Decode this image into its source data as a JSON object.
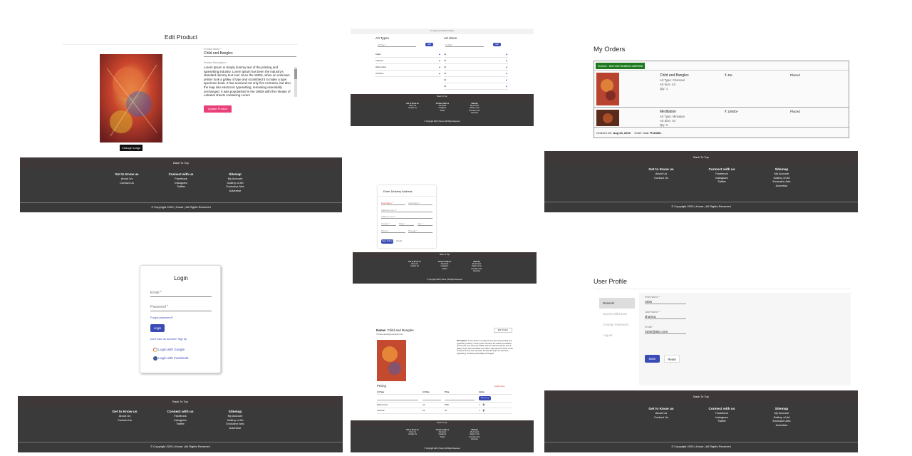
{
  "footer": {
    "back_to_top": "Back To Top",
    "col1_title": "Get to Know us",
    "col1_items": [
      "About Us",
      "Contact Us"
    ],
    "col2_title": "Connect with us",
    "col2_items": [
      "Facebook",
      "Instagram",
      "Twitter"
    ],
    "col3_title": "Sitemap",
    "col3_items": [
      "My Account",
      "Gallery of Art",
      "Exclusive Arts",
      "Advertise"
    ],
    "copyright": "© Copyright 2020 | Hunar | All Rights Reserved"
  },
  "edit_product": {
    "title": "Edit Product",
    "name_label": "Product Name *",
    "name_value": "Child and Bangles",
    "desc_label": "Product Description *",
    "desc_value": "Lorem Ipsum is simply dummy text of the printing and typesetting industry. Lorem Ipsum has been the industry's standard dummy text ever since the 1500s, when an unknown printer took a galley of type and scrambled it to make a type specimen book. It has survived not only five centuries, but also the leap into electronic typesetting, remaining essentially unchanged. It was popularised in the 1960s with the release of Letraset sheets containing Lorem",
    "update_button": "Update Product",
    "change_image": "Change Image"
  },
  "art_types": {
    "breadcrumb": "Art Types and Sizes   Products",
    "types_title": "Art Types",
    "sizes_title": "Art Sizes",
    "type_placeholder": "Art Type *",
    "size_placeholder": "Art Size *",
    "add_label": "ADD",
    "types": [
      "Digital",
      "Charcoal",
      "Water Colors",
      "Oil Paints"
    ],
    "sizes": [
      "A4",
      "A3",
      "A2",
      "A1",
      "A0",
      "A5"
    ]
  },
  "my_orders": {
    "title": "My Orders",
    "order_id_label": "Order# : 5f47c5673b859e1c89f0f06",
    "items": [
      {
        "name": "Child and Bangles",
        "art_type": "Art Type: Charcoal",
        "art_size": "Art Size: A3",
        "qty": "Qty: 1",
        "price": "₹ 45/-",
        "status": "Placed"
      },
      {
        "name": "Meditation",
        "art_type": "Art Type: Miniature",
        "art_size": "Art Size: A3",
        "qty": "Qty: 2",
        "price": "₹ 10800/-",
        "status": "Placed"
      }
    ],
    "ordered_on_label": "Ordered On:",
    "ordered_on_value": "Aug 23, 2020",
    "order_total_label": "Order Total:",
    "order_total_value": "₹13336/-"
  },
  "delivery": {
    "title": "Enter Delivery Address",
    "first_name": "First Name *",
    "last_name": "Last Name *",
    "address1": "Address Line 1 *",
    "address2": "Address Line 2",
    "country": "Country *",
    "state": "State *",
    "city": "City *",
    "phone": "Phone *",
    "pincode": "Pincode *",
    "save_button": "Save & Next",
    "cancel_button": "Cancel"
  },
  "login": {
    "title": "Login",
    "email_label": "Email *",
    "password_label": "Password *",
    "forgot": "Forgot password?",
    "login_button": "Login",
    "signup": "Don't have an account? Sign Up",
    "google": "Login with Google",
    "facebook": "Login with Facebook"
  },
  "product_detail": {
    "name_label": "Name:",
    "name_value": "Child and Bangles",
    "seller": "✉ hello.artist@example.com",
    "edit_button": "Edit Product",
    "desc_label": "Description:",
    "desc_value": "Lorem Ipsum is simply dummy text of the printing and typesetting industry. Lorem Ipsum has been the industry's standard dummy text ever since the 1500s, when an unknown printer took a galley of type and scrambled it to make a type specimen book. It has survived not only five centuries, but also the leap into electronic typesetting, remaining essentially unchanged.",
    "pricing_title": "Pricing",
    "add_pricing_link": "+ Add Pricing",
    "columns": [
      "Art Type",
      "Art Size",
      "Price",
      "Action"
    ],
    "add_button": "Add Pricing",
    "rows": [
      {
        "type": "Water Colors",
        "size": "A4",
        "price": "2000"
      },
      {
        "type": "Charcoal",
        "size": "A3",
        "price": "45"
      }
    ]
  },
  "user_profile": {
    "title": "User Profile",
    "menu": [
      "General",
      "Saved Addresses",
      "Change Password",
      "Logout"
    ],
    "first_name_label": "First Name *",
    "first_name_value": "robin",
    "last_name_label": "Last Name *",
    "last_name_value": "sharma",
    "email_label": "Email *",
    "email_value": "robin@abc.com",
    "save_button": "Save",
    "reset_button": "Reset"
  }
}
